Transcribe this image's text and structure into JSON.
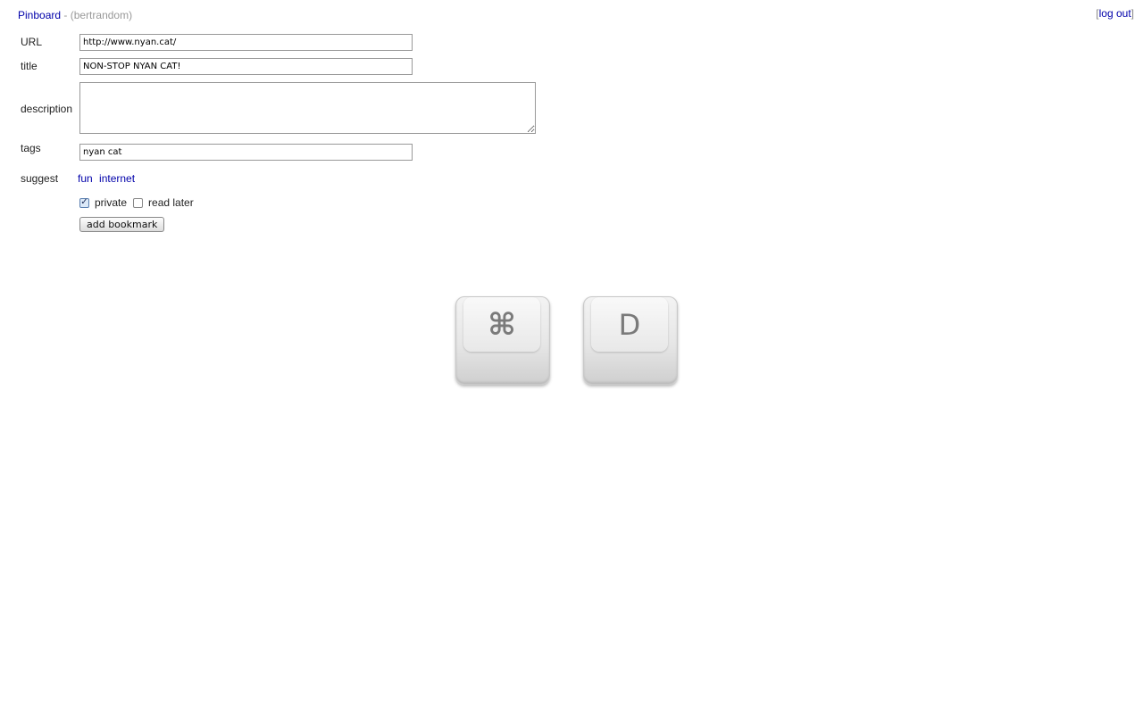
{
  "header": {
    "site_link": "Pinboard",
    "separator": " - ",
    "username": "(bertrandom)"
  },
  "logout": {
    "open": "[",
    "label": "log out",
    "close": "]"
  },
  "form": {
    "url": {
      "label": "URL",
      "value": "http://www.nyan.cat/"
    },
    "title": {
      "label": "title",
      "value": "NON-STOP NYAN CAT!"
    },
    "description": {
      "label": "description",
      "value": ""
    },
    "tags": {
      "label": "tags",
      "value": "nyan cat"
    },
    "suggest": {
      "label": "suggest",
      "items": [
        "fun",
        "internet"
      ]
    },
    "private": {
      "label": "private",
      "checked": true
    },
    "read_later": {
      "label": "read later",
      "checked": false
    },
    "submit_label": "add bookmark"
  },
  "shortcut": {
    "keys": [
      {
        "glyph": "⌘",
        "icon": "command-key-icon"
      },
      {
        "glyph": "D",
        "icon": "d-key-icon"
      }
    ]
  }
}
